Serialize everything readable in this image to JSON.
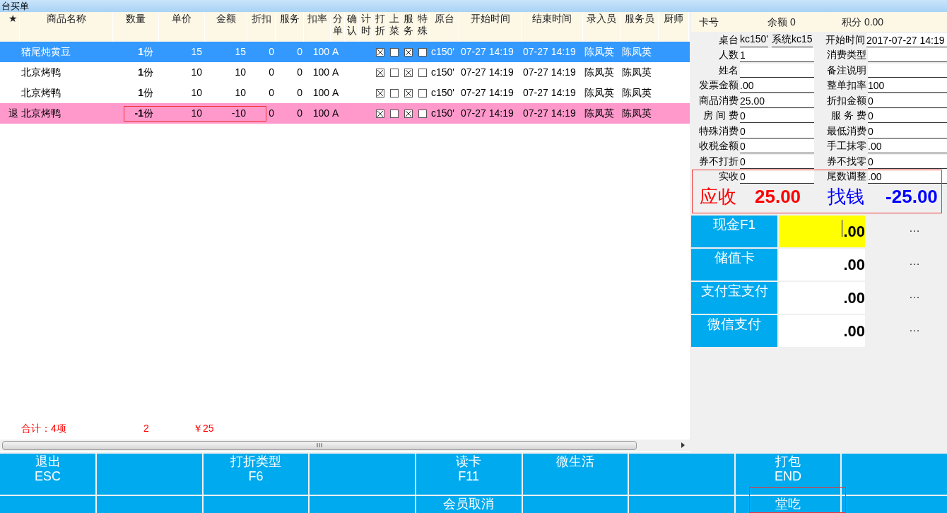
{
  "window": {
    "title": "台买单"
  },
  "table": {
    "columns": [
      "★",
      "商品名称",
      "数量",
      "单价",
      "金额",
      "折扣",
      "服务",
      "扣率",
      "分单",
      "确认",
      "计时",
      "打折",
      "上菜",
      "服务",
      "特殊",
      "原台",
      "开始时间",
      "结束时间",
      "录入员",
      "服务员",
      "厨师"
    ],
    "rows": [
      {
        "selected": true,
        "kind": "normal",
        "name": "猪尾炖黄豆",
        "qty": "1",
        "unit": "份",
        "price": "15",
        "amount": "15",
        "discount": "0",
        "service": "0",
        "rate": "100",
        "split": "A",
        "print_discount": true,
        "served": false,
        "service_flag": true,
        "special": false,
        "table": "c150'",
        "start": "07-27 14:19",
        "end": "07-27 14:19",
        "entered_by": "陈凤英",
        "waiter": "陈凤英"
      },
      {
        "selected": false,
        "kind": "normal",
        "name": "北京烤鸭",
        "qty": "1",
        "unit": "份",
        "price": "10",
        "amount": "10",
        "discount": "0",
        "service": "0",
        "rate": "100",
        "split": "A",
        "print_discount": true,
        "served": false,
        "service_flag": true,
        "special": false,
        "table": "c150'",
        "start": "07-27 14:19",
        "end": "07-27 14:19",
        "entered_by": "陈凤英",
        "waiter": "陈凤英"
      },
      {
        "selected": false,
        "kind": "normal",
        "name": "北京烤鸭",
        "qty": "1",
        "unit": "份",
        "price": "10",
        "amount": "10",
        "discount": "0",
        "service": "0",
        "rate": "100",
        "split": "A",
        "print_discount": true,
        "served": false,
        "service_flag": true,
        "special": false,
        "table": "c150'",
        "start": "07-27 14:19",
        "end": "07-27 14:19",
        "entered_by": "陈凤英",
        "waiter": "陈凤英"
      },
      {
        "selected": false,
        "kind": "return",
        "mark": "退",
        "name": "北京烤鸭",
        "qty": "-1",
        "unit": "份",
        "price": "10",
        "amount": "-10",
        "discount": "0",
        "service": "0",
        "rate": "100",
        "split": "A",
        "print_discount": true,
        "served": false,
        "service_flag": true,
        "special": false,
        "table": "c150'",
        "start": "07-27 14:19",
        "end": "07-27 14:19",
        "entered_by": "陈凤英",
        "waiter": "陈凤英"
      }
    ],
    "summary": {
      "count": "合计：4项",
      "qty": "2",
      "amount": "￥25"
    }
  },
  "member": {
    "card_label": "卡号",
    "balance": "余额 0",
    "points": "积分 0.00"
  },
  "form": [
    {
      "label": "桌台",
      "values": [
        "kc150'",
        "系统kc15"
      ],
      "right_label": "开始时间",
      "right_value": "2017-07-27 14:19"
    },
    {
      "label": "人数",
      "values": [
        "1"
      ],
      "right_label": "消费类型"
    },
    {
      "label": "姓名",
      "right_label": "备注说明"
    },
    {
      "label": "发票金额",
      "values": [
        ".00"
      ],
      "right_label": "整单扣率",
      "right_value": "100"
    },
    {
      "label": "商品消费",
      "values": [
        "25.00"
      ],
      "right_label": "折扣金额",
      "right_value": "0"
    },
    {
      "label": "房 间 费",
      "values": [
        "0"
      ],
      "right_label": "服 务 费",
      "right_value": "0"
    },
    {
      "label": "特殊消费",
      "values": [
        "0"
      ],
      "right_label": "最低消费",
      "right_value": "0"
    },
    {
      "label": "收税金额",
      "values": [
        "0"
      ],
      "right_label": "手工抹零",
      "right_value": ".00"
    },
    {
      "label": "券不打折",
      "values": [
        "0"
      ],
      "right_label": "券不找零",
      "right_value": "0"
    },
    {
      "label": "实收",
      "values": [
        "0"
      ],
      "right_label": "尾数调整",
      "right_value": ".00"
    }
  ],
  "totals": {
    "due_label": "应收",
    "due": "25.00",
    "change_label": "找钱",
    "change": "-25.00"
  },
  "payments": [
    {
      "label": "现金F1",
      "value": ".00",
      "selected": true,
      "more": "…"
    },
    {
      "label": "储值卡",
      "value": ".00",
      "selected": false,
      "more": "…"
    },
    {
      "label": "支付宝支付",
      "value": ".00",
      "selected": false,
      "more": "…"
    },
    {
      "label": "微信支付",
      "value": ".00",
      "selected": false,
      "more": "…"
    }
  ],
  "buttons": [
    [
      {
        "kind": "labeled",
        "label": "退出",
        "key": "ESC"
      },
      {
        "kind": "blank"
      },
      {
        "kind": "labeled",
        "label": "打折类型",
        "key": "F6"
      },
      {
        "kind": "blank"
      },
      {
        "kind": "labeled",
        "label": "读卡",
        "key": "F11"
      },
      {
        "kind": "labeled",
        "label": "微生活"
      },
      {
        "kind": "blank"
      },
      {
        "kind": "labeled",
        "label": "打包",
        "key": "END"
      },
      {
        "kind": "blank"
      }
    ],
    [
      {
        "kind": "blank"
      },
      {
        "kind": "blank"
      },
      {
        "kind": "blank"
      },
      {
        "kind": "blank"
      },
      {
        "kind": "labeled",
        "label": "会员取消"
      },
      {
        "kind": "blank"
      },
      {
        "kind": "blank"
      },
      {
        "kind": "labeled",
        "label": "堂吃"
      },
      {
        "kind": "blank"
      }
    ]
  ]
}
